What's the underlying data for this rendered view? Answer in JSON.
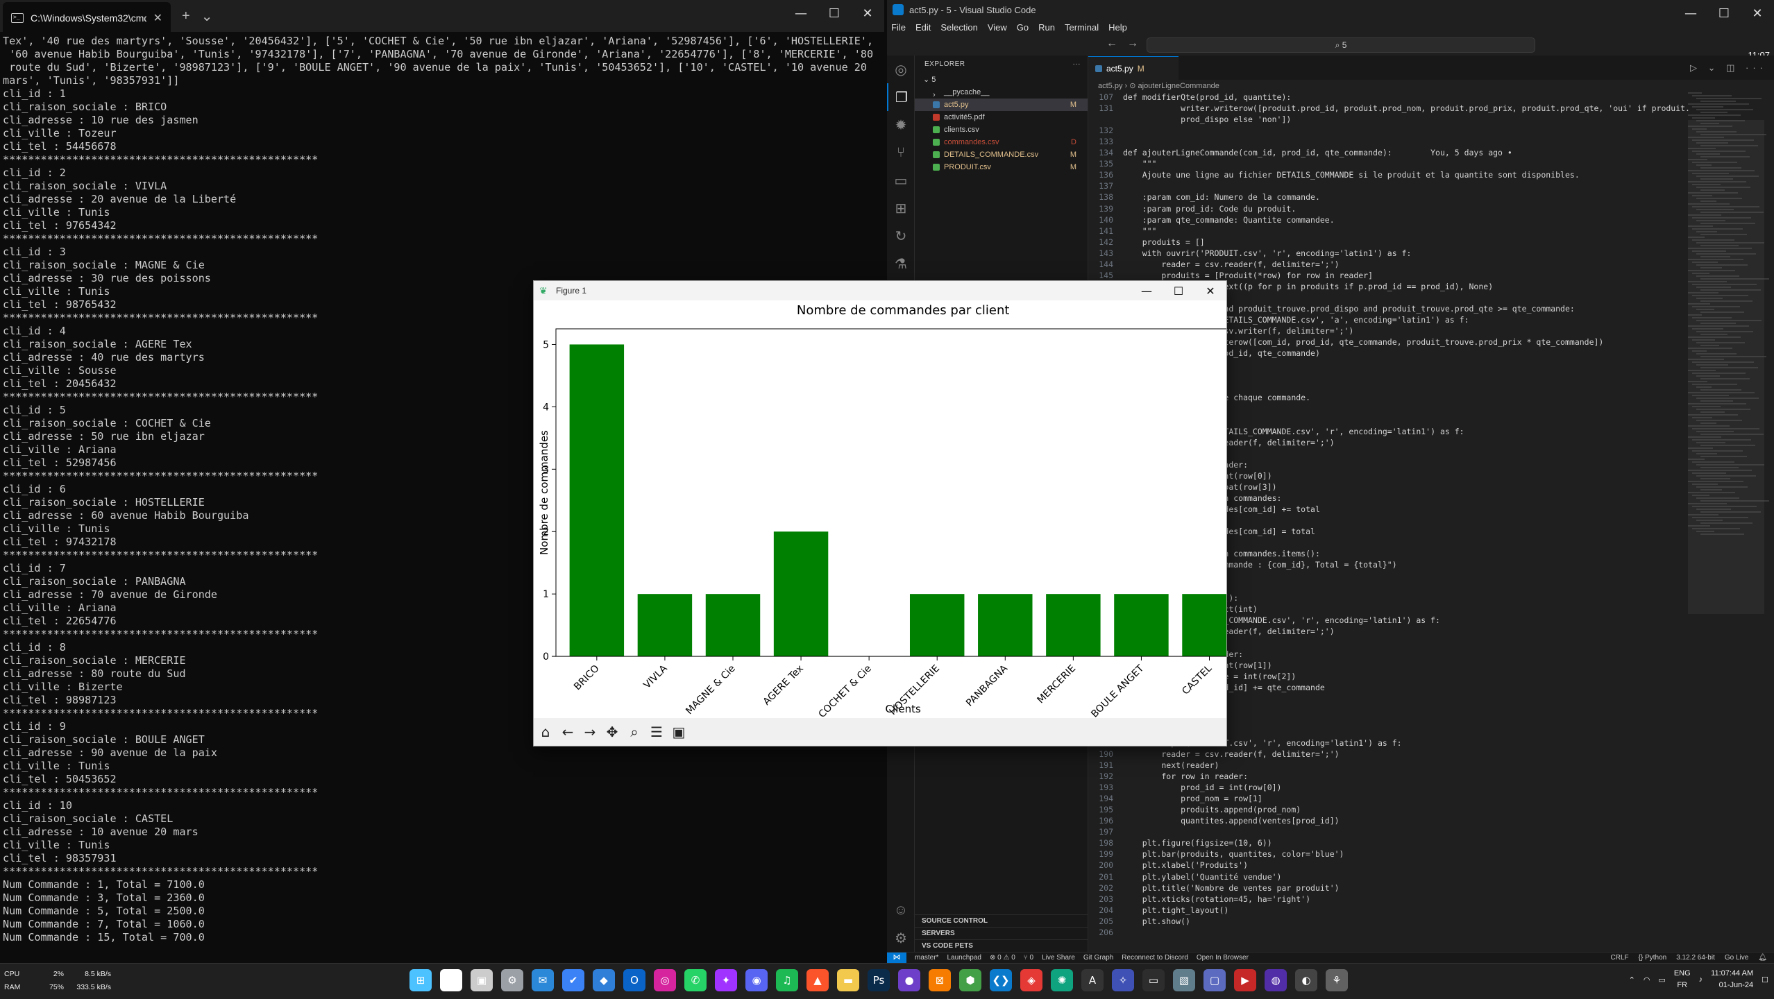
{
  "cmd": {
    "tab_title": "C:\\Windows\\System32\\cmd.e",
    "new_tab": "+",
    "dropdown": "⌄",
    "lines": [
      "Tex', '40 rue des martyrs', 'Sousse', '20456432'], ['5', 'COCHET & Cie', '50 rue ibn eljazar', 'Ariana', '52987456'], ['6', 'HOSTELLERIE',",
      " '60 avenue Habib Bourguiba', 'Tunis', '97432178'], ['7', 'PANBAGNA', '70 avenue de Gironde', 'Ariana', '22654776'], ['8', 'MERCERIE', '80",
      " route du Sud', 'Bizerte', '98987123'], ['9', 'BOULE ANGET', '90 avenue de la paix', 'Tunis', '50453652'], ['10', 'CASTEL', '10 avenue 20",
      "mars', 'Tunis', '98357931']]",
      "cli_id : 1",
      "cli_raison_sociale : BRICO",
      "cli_adresse : 10 rue des jasmen",
      "cli_ville : Tozeur",
      "cli_tel : 54456678",
      "**************************************************",
      "cli_id : 2",
      "cli_raison_sociale : VIVLA",
      "cli_adresse : 20 avenue de la Liberté",
      "cli_ville : Tunis",
      "cli_tel : 97654342",
      "**************************************************",
      "cli_id : 3",
      "cli_raison_sociale : MAGNE & Cie",
      "cli_adresse : 30 rue des poissons",
      "cli_ville : Tunis",
      "cli_tel : 98765432",
      "**************************************************",
      "cli_id : 4",
      "cli_raison_sociale : AGERE Tex",
      "cli_adresse : 40 rue des martyrs",
      "cli_ville : Sousse",
      "cli_tel : 20456432",
      "**************************************************",
      "cli_id : 5",
      "cli_raison_sociale : COCHET & Cie",
      "cli_adresse : 50 rue ibn eljazar",
      "cli_ville : Ariana",
      "cli_tel : 52987456",
      "**************************************************",
      "cli_id : 6",
      "cli_raison_sociale : HOSTELLERIE",
      "cli_adresse : 60 avenue Habib Bourguiba",
      "cli_ville : Tunis",
      "cli_tel : 97432178",
      "**************************************************",
      "cli_id : 7",
      "cli_raison_sociale : PANBAGNA",
      "cli_adresse : 70 avenue de Gironde",
      "cli_ville : Ariana",
      "cli_tel : 22654776",
      "**************************************************",
      "cli_id : 8",
      "cli_raison_sociale : MERCERIE",
      "cli_adresse : 80 route du Sud",
      "cli_ville : Bizerte",
      "cli_tel : 98987123",
      "**************************************************",
      "cli_id : 9",
      "cli_raison_sociale : BOULE ANGET",
      "cli_adresse : 90 avenue de la paix",
      "cli_ville : Tunis",
      "cli_tel : 50453652",
      "**************************************************",
      "cli_id : 10",
      "cli_raison_sociale : CASTEL",
      "cli_adresse : 10 avenue 20 mars",
      "cli_ville : Tunis",
      "cli_tel : 98357931",
      "**************************************************",
      "Num Commande : 1, Total = 7100.0",
      "Num Commande : 3, Total = 2360.0",
      "Num Commande : 5, Total = 2500.0",
      "Num Commande : 7, Total = 1060.0",
      "Num Commande : 15, Total = 700.0"
    ]
  },
  "vscode": {
    "window_title": "act5.py - 5 - Visual Studio Code",
    "menu": [
      "File",
      "Edit",
      "Selection",
      "View",
      "Go",
      "Run",
      "Terminal",
      "Help"
    ],
    "search": "5",
    "time_overlay": "11:07",
    "explorer_title": "EXPLORER",
    "root_folder": "5",
    "files": [
      {
        "name": "__pycache__",
        "badge": "",
        "color": "#cccccc",
        "icon": "folder-icon"
      },
      {
        "name": "act5.py",
        "badge": "M",
        "color": "#e2c08d",
        "icon": "python-icon"
      },
      {
        "name": "activité5.pdf",
        "badge": "",
        "color": "#cccccc",
        "icon": "pdf-icon"
      },
      {
        "name": "clients.csv",
        "badge": "",
        "color": "#cccccc",
        "icon": "csv-icon"
      },
      {
        "name": "commandes.csv",
        "badge": "D",
        "color": "#c74e39",
        "icon": "csv-icon"
      },
      {
        "name": "DETAILS_COMMANDE.csv",
        "badge": "M",
        "color": "#e2c08d",
        "icon": "csv-icon"
      },
      {
        "name": "PRODUIT.csv",
        "badge": "M",
        "color": "#e2c08d",
        "icon": "csv-icon"
      }
    ],
    "sections": [
      "SOURCE CONTROL",
      "SERVERS",
      "VS CODE PETS"
    ],
    "editor_tab": "act5.py",
    "editor_tab_badge": "M",
    "breadcrumb": "act5.py › ⊙ ajouterLigneCommande",
    "code": [
      {
        "n": "107",
        "t": "def modifierQte(prod_id, quantite):"
      },
      {
        "n": "131",
        "t": "            writer.writerow([produit.prod_id, produit.prod_nom, produit.prod_prix, produit.prod_qte, 'oui' if produit."
      },
      {
        "n": "",
        "t": "            prod_dispo else 'non'])"
      },
      {
        "n": "132",
        "t": ""
      },
      {
        "n": "133",
        "t": ""
      },
      {
        "n": "134",
        "t": "def ajouterLigneCommande(com_id, prod_id, qte_commande):        You, 5 days ago •"
      },
      {
        "n": "135",
        "t": "    \"\"\""
      },
      {
        "n": "136",
        "t": "    Ajoute une ligne au fichier DETAILS_COMMANDE si le produit et la quantite sont disponibles."
      },
      {
        "n": "137",
        "t": ""
      },
      {
        "n": "138",
        "t": "    :param com_id: Numero de la commande."
      },
      {
        "n": "139",
        "t": "    :param prod_id: Code du produit."
      },
      {
        "n": "140",
        "t": "    :param qte_commande: Quantite commandee."
      },
      {
        "n": "141",
        "t": "    \"\"\""
      },
      {
        "n": "142",
        "t": "    produits = []"
      },
      {
        "n": "143",
        "t": "    with ouvrir('PRODUIT.csv', 'r', encoding='latin1') as f:"
      },
      {
        "n": "144",
        "t": "        reader = csv.reader(f, delimiter=';')"
      },
      {
        "n": "145",
        "t": "        produits = [Produit(*row) for row in reader]"
      },
      {
        "n": "",
        "t": "                    next((p for p in produits if p.prod_id == prod_id), None)"
      },
      {
        "n": "",
        "t": ""
      },
      {
        "n": "",
        "t": "                    and produit_trouve.prod_dispo and produit_trouve.prod_qte >= qte_commande:"
      },
      {
        "n": "",
        "t": "                    DETAILS_COMMANDE.csv', 'a', encoding='latin1') as f:"
      },
      {
        "n": "",
        "t": "                    csv.writer(f, delimiter=';')"
      },
      {
        "n": "",
        "t": "                    iterow([com_id, prod_id, qte_commande, produit_trouve.prod_prix * qte_commande])"
      },
      {
        "n": "",
        "t": "                    rod_id, qte_commande)"
      },
      {
        "n": "",
        "t": ""
      },
      {
        "n": "",
        "t": ""
      },
      {
        "n": "",
        "t": ""
      },
      {
        "n": "",
        "t": "                    de chaque commande."
      },
      {
        "n": "",
        "t": ""
      },
      {
        "n": "",
        "t": ""
      },
      {
        "n": "",
        "t": "                    ETAILS_COMMANDE.csv', 'r', encoding='latin1') as f:"
      },
      {
        "n": "",
        "t": "                    reader(f, delimiter=';')"
      },
      {
        "n": "",
        "t": ""
      },
      {
        "n": "",
        "t": "                    eader:"
      },
      {
        "n": "",
        "t": "                    int(row[0])"
      },
      {
        "n": "",
        "t": "                    loat(row[3])"
      },
      {
        "n": "",
        "t": "                    in commandes:"
      },
      {
        "n": "",
        "t": "                    ndes[com_id] += total"
      },
      {
        "n": "",
        "t": ""
      },
      {
        "n": "",
        "t": "                    ndes[com_id] = total"
      },
      {
        "n": "",
        "t": ""
      },
      {
        "n": "",
        "t": "                    in commandes.items():"
      },
      {
        "n": "",
        "t": "                    ommande : {com_id}, Total = {total}\")"
      },
      {
        "n": "",
        "t": ""
      },
      {
        "n": "",
        "t": ""
      },
      {
        "n": "",
        "t": "                    t():"
      },
      {
        "n": "",
        "t": "                    ict(int)"
      },
      {
        "n": "",
        "t": "                    S_COMMANDE.csv', 'r', encoding='latin1') as f:"
      },
      {
        "n": "",
        "t": "                    reader(f, delimiter=';')"
      },
      {
        "n": "",
        "t": ""
      },
      {
        "n": "",
        "t": "                    ader:"
      },
      {
        "n": "",
        "t": "                    int(row[1])"
      },
      {
        "n": "",
        "t": "                    de = int(row[2])"
      },
      {
        "n": "",
        "t": "                    od_id] += qte_commande"
      },
      {
        "n": "",
        "t": ""
      },
      {
        "n": "",
        "t": ""
      },
      {
        "n": "",
        "t": ""
      },
      {
        "n": "",
        "t": ""
      },
      {
        "n": "189",
        "t": "    with open('PRODUIT.csv', 'r', encoding='latin1') as f:"
      },
      {
        "n": "190",
        "t": "        reader = csv.reader(f, delimiter=';')"
      },
      {
        "n": "191",
        "t": "        next(reader)"
      },
      {
        "n": "192",
        "t": "        for row in reader:"
      },
      {
        "n": "193",
        "t": "            prod_id = int(row[0])"
      },
      {
        "n": "194",
        "t": "            prod_nom = row[1]"
      },
      {
        "n": "195",
        "t": "            produits.append(prod_nom)"
      },
      {
        "n": "196",
        "t": "            quantites.append(ventes[prod_id])"
      },
      {
        "n": "197",
        "t": ""
      },
      {
        "n": "198",
        "t": "    plt.figure(figsize=(10, 6))"
      },
      {
        "n": "199",
        "t": "    plt.bar(produits, quantites, color='blue')"
      },
      {
        "n": "200",
        "t": "    plt.xlabel('Produits')"
      },
      {
        "n": "201",
        "t": "    plt.ylabel('Quantité vendue')"
      },
      {
        "n": "202",
        "t": "    plt.title('Nombre de ventes par produit')"
      },
      {
        "n": "203",
        "t": "    plt.xticks(rotation=45, ha='right')"
      },
      {
        "n": "204",
        "t": "    plt.tight_layout()"
      },
      {
        "n": "205",
        "t": "    plt.show()"
      },
      {
        "n": "206",
        "t": ""
      }
    ],
    "status": {
      "branch": "master*",
      "launchpad": "Launchpad",
      "problems": "⊗ 0 ⚠ 0",
      "ports": "⑂ 0",
      "live_share": "Live Share",
      "git_graph": "Git Graph",
      "discord": "Reconnect to Discord",
      "browser": "Open In Browser",
      "eol": "CRLF",
      "lang": "{} Python",
      "interpreter": "3.12.2 64-bit",
      "go_live": "Go Live"
    }
  },
  "figure": {
    "window_title": "Figure 1",
    "toolbar_icons": [
      "home-icon",
      "back-icon",
      "forward-icon",
      "pan-icon",
      "zoom-icon",
      "configure-icon",
      "save-icon"
    ]
  },
  "chart_data": {
    "type": "bar",
    "title": "Nombre de commandes par client",
    "xlabel": "Clients",
    "ylabel": "Nombre de commandes",
    "categories": [
      "BRICO",
      "VIVLA",
      "MAGNE & Cie",
      "AGERE Tex",
      "COCHET & Cie",
      "HOSTELLERIE",
      "PANBAGNA",
      "MERCERIE",
      "BOULE ANGET",
      "CASTEL"
    ],
    "values": [
      5,
      1,
      1,
      2,
      0,
      1,
      1,
      1,
      1,
      1
    ],
    "ylim": [
      0,
      5.25
    ],
    "yticks": [
      0,
      1,
      2,
      3,
      4,
      5
    ],
    "color": "#008000",
    "grid": false
  },
  "taskbar": {
    "cpu_label": "CPU",
    "cpu_value": "2%",
    "net_up": "8.5 kB/s",
    "ram_label": "RAM",
    "ram_value": "75%",
    "net_down": "333.5 kB/s",
    "lang_1": "ENG",
    "lang_2": "FR",
    "time": "11:07:44 AM",
    "date": "01-Jun-24",
    "apps": [
      {
        "name": "start-icon",
        "glyph": "⊞",
        "color": "#4cc2ff"
      },
      {
        "name": "search-icon",
        "glyph": "⌕",
        "color": "#ffffff"
      },
      {
        "name": "task-view-icon",
        "glyph": "▣",
        "color": "#cccccc"
      },
      {
        "name": "settings-icon",
        "glyph": "⚙",
        "color": "#9aa0a6"
      },
      {
        "name": "mail-icon",
        "glyph": "✉",
        "color": "#2b88d8"
      },
      {
        "name": "todo-icon",
        "glyph": "✔",
        "color": "#3b82f6"
      },
      {
        "name": "box-icon",
        "glyph": "◆",
        "color": "#2f7ed8"
      },
      {
        "name": "outlook-icon",
        "glyph": "O",
        "color": "#0a64c8"
      },
      {
        "name": "instagram-icon",
        "glyph": "◎",
        "color": "#d6249f"
      },
      {
        "name": "whatsapp-icon",
        "glyph": "✆",
        "color": "#25d366"
      },
      {
        "name": "messenger-icon",
        "glyph": "✦",
        "color": "#a033ff"
      },
      {
        "name": "discord-icon",
        "glyph": "◉",
        "color": "#5865f2"
      },
      {
        "name": "spotify-icon",
        "glyph": "♫",
        "color": "#1db954"
      },
      {
        "name": "brave-icon",
        "glyph": "▲",
        "color": "#fb542b"
      },
      {
        "name": "explorer-icon",
        "glyph": "▬",
        "color": "#f2c94c"
      },
      {
        "name": "photoshop-icon",
        "glyph": "Ps",
        "color": "#0b2b4b"
      },
      {
        "name": "github-icon",
        "glyph": "●",
        "color": "#6e40c9"
      },
      {
        "name": "xampp-icon",
        "glyph": "⊠",
        "color": "#f57c00"
      },
      {
        "name": "node-icon",
        "glyph": "⬢",
        "color": "#43a047"
      },
      {
        "name": "vscode-icon",
        "glyph": "❮❯",
        "color": "#0a7acc"
      },
      {
        "name": "anydesk-icon",
        "glyph": "◈",
        "color": "#e53935"
      },
      {
        "name": "chatgpt-icon",
        "glyph": "✺",
        "color": "#10a37f"
      },
      {
        "name": "a-icon",
        "glyph": "A",
        "color": "#333333"
      },
      {
        "name": "gemini-icon",
        "glyph": "✧",
        "color": "#3f51b5"
      },
      {
        "name": "terminal-icon",
        "glyph": "▭",
        "color": "#2d2d2d"
      },
      {
        "name": "photos-icon",
        "glyph": "▧",
        "color": "#607d8b"
      },
      {
        "name": "window-icon",
        "glyph": "▢",
        "color": "#5c6bc0"
      },
      {
        "name": "media-icon",
        "glyph": "▶",
        "color": "#c62828"
      },
      {
        "name": "obs-icon",
        "glyph": "◍",
        "color": "#512da8"
      },
      {
        "name": "github-desktop-icon",
        "glyph": "◐",
        "color": "#444444"
      },
      {
        "name": "python-icon",
        "glyph": "⚘",
        "color": "#616161"
      }
    ]
  }
}
